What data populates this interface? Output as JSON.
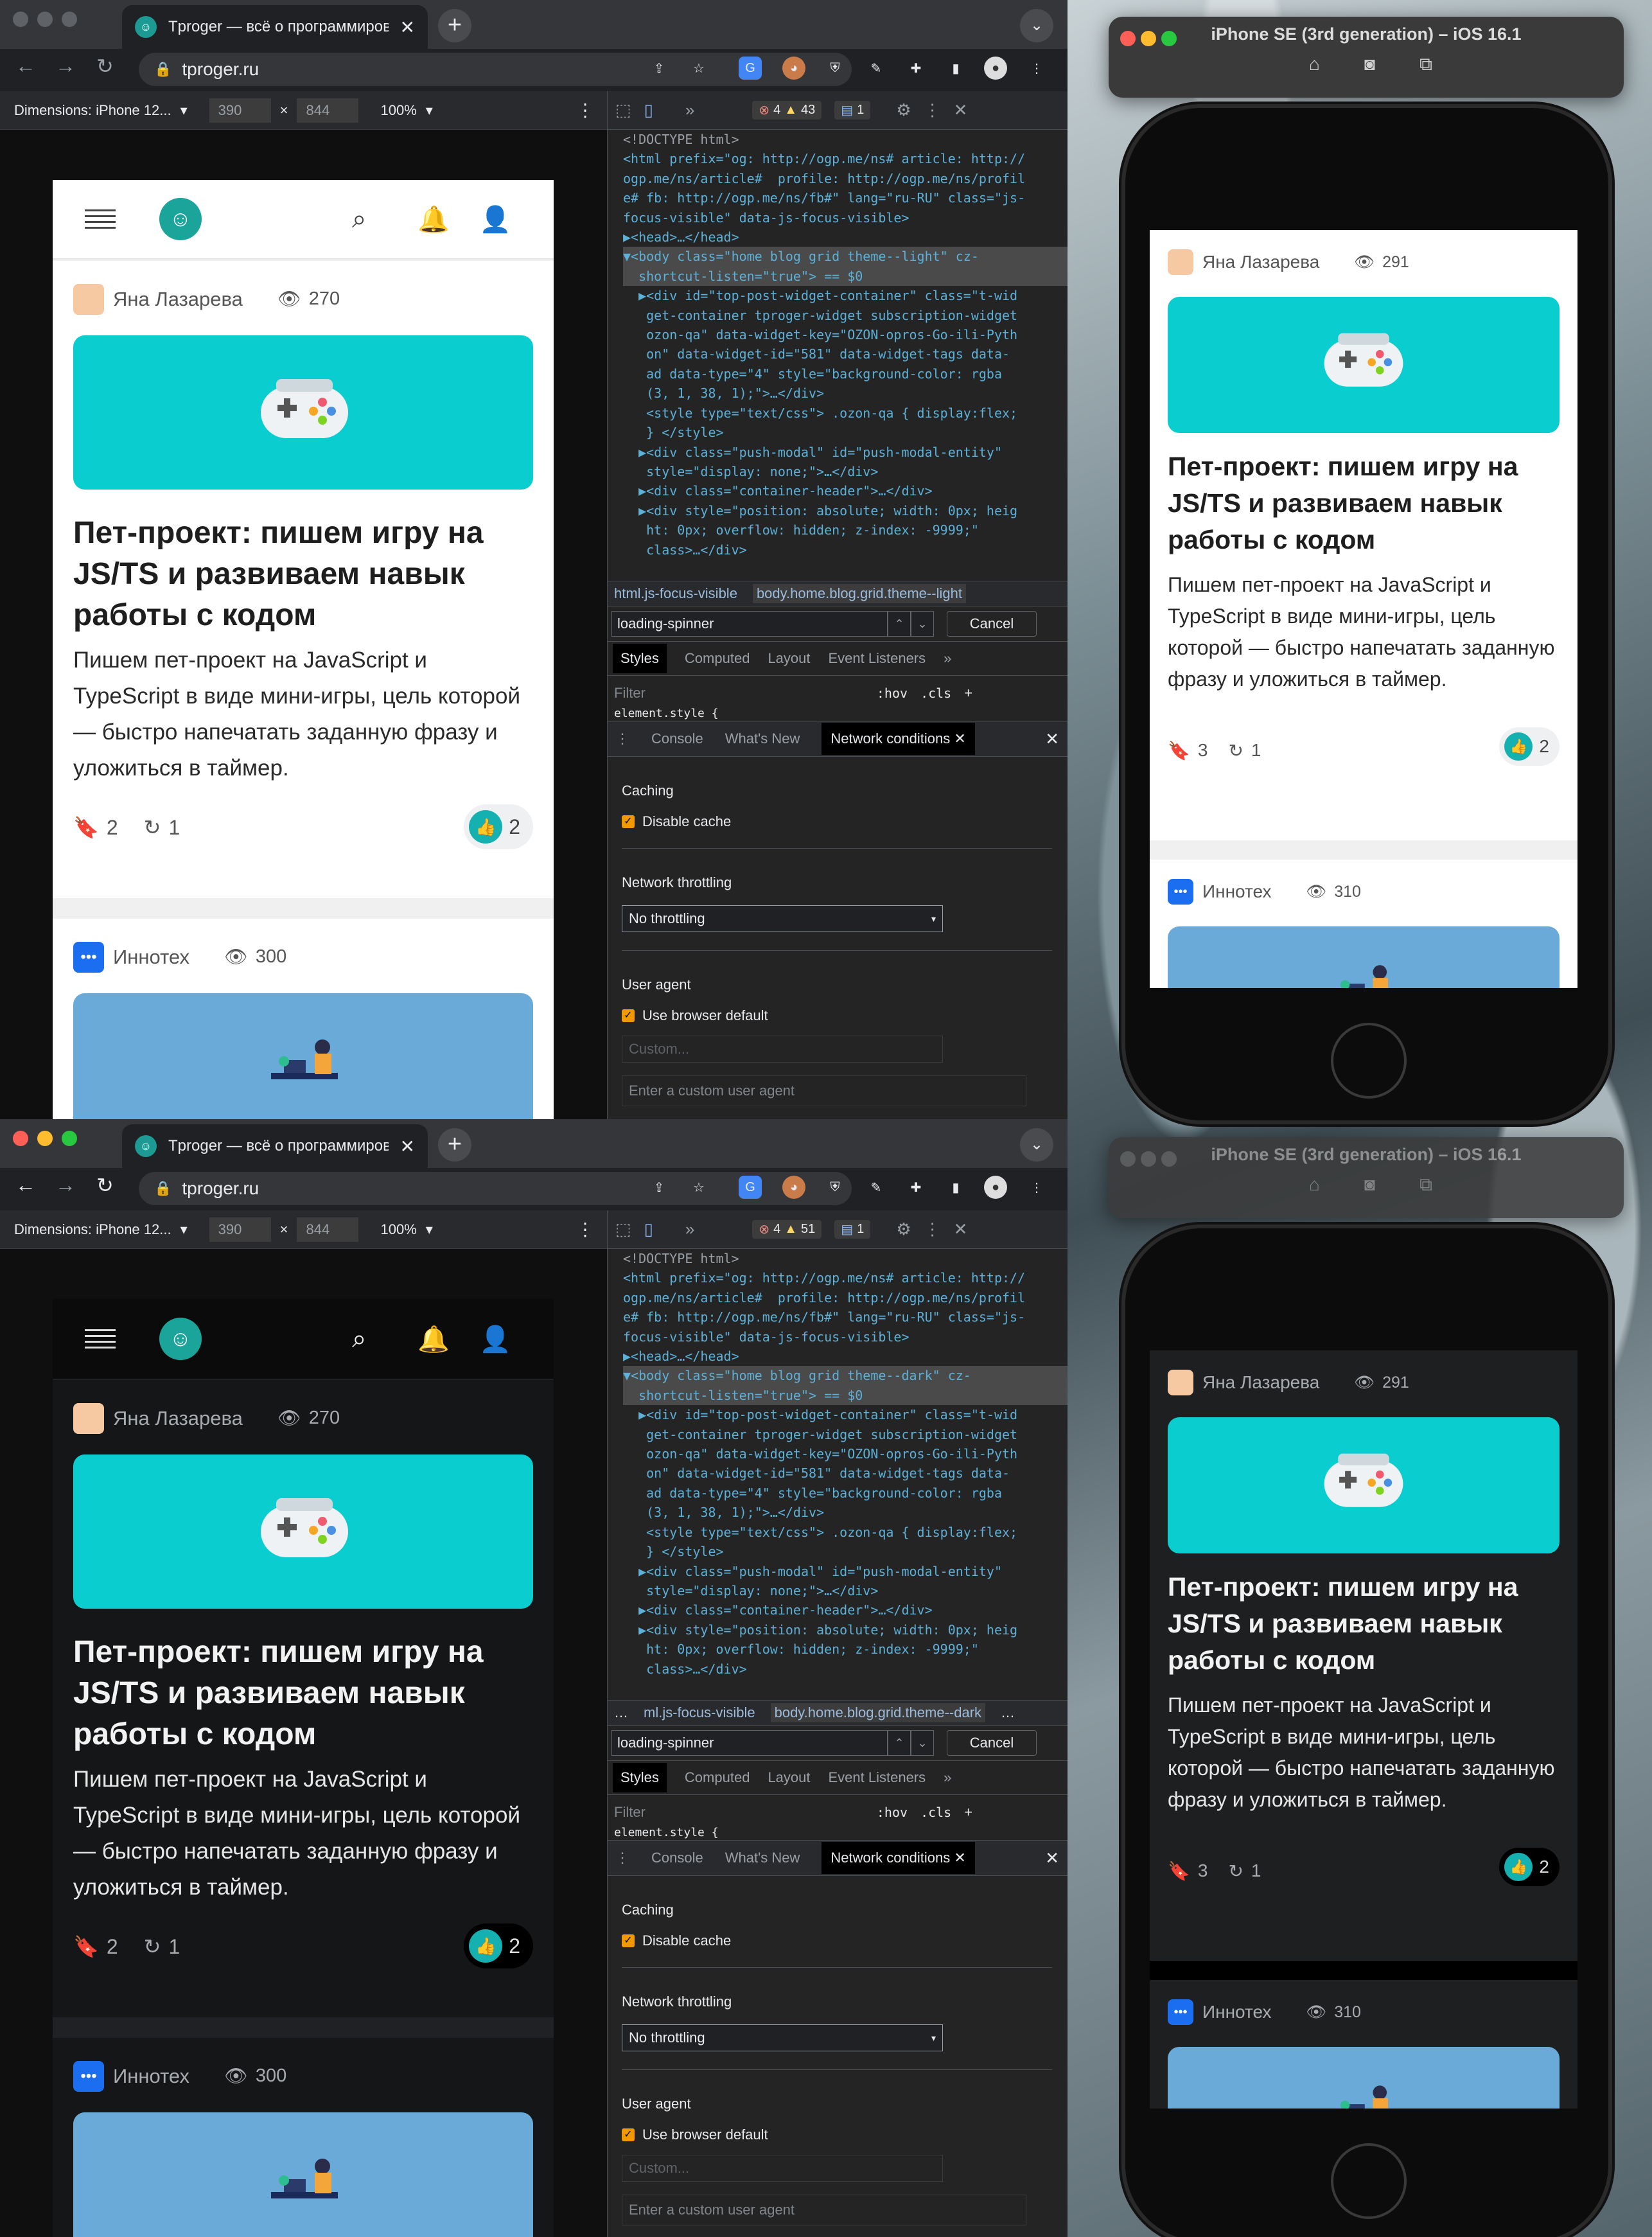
{
  "browser": {
    "tab_title": "Tproger — всё о программировании",
    "url": "tproger.ru",
    "new_tab": "+",
    "close": "✕"
  },
  "devbar": {
    "dimensions_label": "Dimensions: iPhone 12...",
    "width": "390",
    "height": "844",
    "times": "×",
    "zoom": "100%"
  },
  "windows": [
    {
      "errors": "4",
      "warnings": "43",
      "messages": "1",
      "code": [
        {
          "t": "<!DOCTYPE html>",
          "c": "cm"
        },
        {
          "t": "<html prefix=\"og: http://ogp.me/ns# article: http://",
          "c": "tg"
        },
        {
          "t": "ogp.me/ns/article#  profile: http://ogp.me/ns/profil",
          "c": "tg"
        },
        {
          "t": "e# fb: http://ogp.me/ns/fb#\" lang=\"ru-RU\" class=\"js-",
          "c": "tg"
        },
        {
          "t": "focus-visible\" data-js-focus-visible>",
          "c": "tg"
        },
        {
          "t": "▶<head>…</head>",
          "c": "tg"
        },
        {
          "t": "▼<body class=\"home blog grid theme--light\" cz-",
          "c": "tg sel"
        },
        {
          "t": "  shortcut-listen=\"true\"> == $0",
          "c": "tg sel"
        },
        {
          "t": "  ▶<div id=\"top-post-widget-container\" class=\"t-wid",
          "c": "tg"
        },
        {
          "t": "   get-container tproger-widget subscription-widget",
          "c": "tg"
        },
        {
          "t": "   ozon-qa\" data-widget-key=\"OZON-opros-Go-ili-Pyth",
          "c": "tg"
        },
        {
          "t": "   on\" data-widget-id=\"581\" data-widget-tags data-",
          "c": "tg"
        },
        {
          "t": "   ad data-type=\"4\" style=\"background-color: rgba",
          "c": "tg"
        },
        {
          "t": "   (3, 1, 38, 1);\">…</div>",
          "c": "tg"
        },
        {
          "t": "   <style type=\"text/css\"> .ozon-qa { display:flex;",
          "c": "tg"
        },
        {
          "t": "   } </style>",
          "c": "tg"
        },
        {
          "t": "  ▶<div class=\"push-modal\" id=\"push-modal-entity\"",
          "c": "tg"
        },
        {
          "t": "   style=\"display: none;\">…</div>",
          "c": "tg"
        },
        {
          "t": "  ▶<div class=\"container-header\">…</div>",
          "c": "tg"
        },
        {
          "t": "  ▶<div style=\"position: absolute; width: 0px; heig",
          "c": "tg"
        },
        {
          "t": "   ht: 0px; overflow: hidden; z-index: -9999;\"",
          "c": "tg"
        },
        {
          "t": "   class>…</div>",
          "c": "tg"
        }
      ],
      "crumb1": "html.js-focus-visible",
      "crumb2": "body.home.blog.grid.theme--light"
    },
    {
      "errors": "4",
      "warnings": "51",
      "messages": "1",
      "code": [
        {
          "t": "<!DOCTYPE html>",
          "c": "cm"
        },
        {
          "t": "<html prefix=\"og: http://ogp.me/ns# article: http://",
          "c": "tg"
        },
        {
          "t": "ogp.me/ns/article#  profile: http://ogp.me/ns/profil",
          "c": "tg"
        },
        {
          "t": "e# fb: http://ogp.me/ns/fb#\" lang=\"ru-RU\" class=\"js-",
          "c": "tg"
        },
        {
          "t": "focus-visible\" data-js-focus-visible>",
          "c": "tg"
        },
        {
          "t": "▶<head>…</head>",
          "c": "tg"
        },
        {
          "t": "▼<body class=\"home blog grid theme--dark\" cz-",
          "c": "tg sel"
        },
        {
          "t": "  shortcut-listen=\"true\"> == $0",
          "c": "tg sel"
        },
        {
          "t": "  ▶<div id=\"top-post-widget-container\" class=\"t-wid",
          "c": "tg"
        },
        {
          "t": "   get-container tproger-widget subscription-widget",
          "c": "tg"
        },
        {
          "t": "   ozon-qa\" data-widget-key=\"OZON-opros-Go-ili-Pyth",
          "c": "tg"
        },
        {
          "t": "   on\" data-widget-id=\"581\" data-widget-tags data-",
          "c": "tg"
        },
        {
          "t": "   ad data-type=\"4\" style=\"background-color: rgba",
          "c": "tg"
        },
        {
          "t": "   (3, 1, 38, 1);\">…</div>",
          "c": "tg"
        },
        {
          "t": "   <style type=\"text/css\"> .ozon-qa { display:flex;",
          "c": "tg"
        },
        {
          "t": "   } </style>",
          "c": "tg"
        },
        {
          "t": "  ▶<div class=\"push-modal\" id=\"push-modal-entity\"",
          "c": "tg"
        },
        {
          "t": "   style=\"display: none;\">…</div>",
          "c": "tg"
        },
        {
          "t": "  ▶<div class=\"container-header\">…</div>",
          "c": "tg"
        },
        {
          "t": "  ▶<div style=\"position: absolute; width: 0px; heig",
          "c": "tg"
        },
        {
          "t": "   ht: 0px; overflow: hidden; z-index: -9999;\"",
          "c": "tg"
        },
        {
          "t": "   class>…</div>",
          "c": "tg"
        }
      ],
      "crumb1": "ml.js-focus-visible",
      "crumb2": "body.home.blog.grid.theme--dark"
    }
  ],
  "devtools": {
    "search_value": "loading-spinner",
    "cancel": "Cancel",
    "tabs": [
      "Styles",
      "Computed",
      "Layout",
      "Event Listeners"
    ],
    "filter_placeholder": "Filter",
    "hov": ":hov",
    "cls": ".cls",
    "element_style": "element.style {",
    "drawer_tabs": [
      "Console",
      "What's New",
      "Network conditions"
    ],
    "caching": "Caching",
    "disable_cache": "Disable cache",
    "throttling": "Network throttling",
    "throttling_value": "No throttling",
    "user_agent": "User agent",
    "use_default": "Use browser default",
    "custom": "Custom...",
    "custom_placeholder": "Enter a custom user agent"
  },
  "desktop_post": {
    "author": "Яна Лазарева",
    "views": "270",
    "title": "Пет-проект: пишем игру на JS/TS и развиваем навык работы с кодом",
    "desc": "Пишем пет-проект на JavaScript и TypeScript в виде мини-игры, цель которой — быстро напечатать заданную фразу и уложиться в таймер.",
    "bookmarks": "2",
    "reposts": "1",
    "likes": "2",
    "next_author": "Иннотех",
    "next_views": "300"
  },
  "mobile_post": {
    "author": "Яна Лазарева",
    "views": "291",
    "title": "Пет-проект: пишем игру на JS/TS и развиваем навык работы с кодом",
    "desc": "Пишем пет-проект на JavaScript и TypeScript в виде мини-игры, цель которой — быстро напечатать заданную фразу и уложиться в таймер.",
    "bookmarks": "3",
    "reposts": "1",
    "likes": "2",
    "next_author": "Иннотех",
    "next_views": "310"
  },
  "simulator": {
    "title": "iPhone SE (3rd generation) – iOS 16.1"
  },
  "colors": {
    "teal": "#0acdd0",
    "brand": "#1aa49a",
    "devtools_bg": "#242424"
  }
}
